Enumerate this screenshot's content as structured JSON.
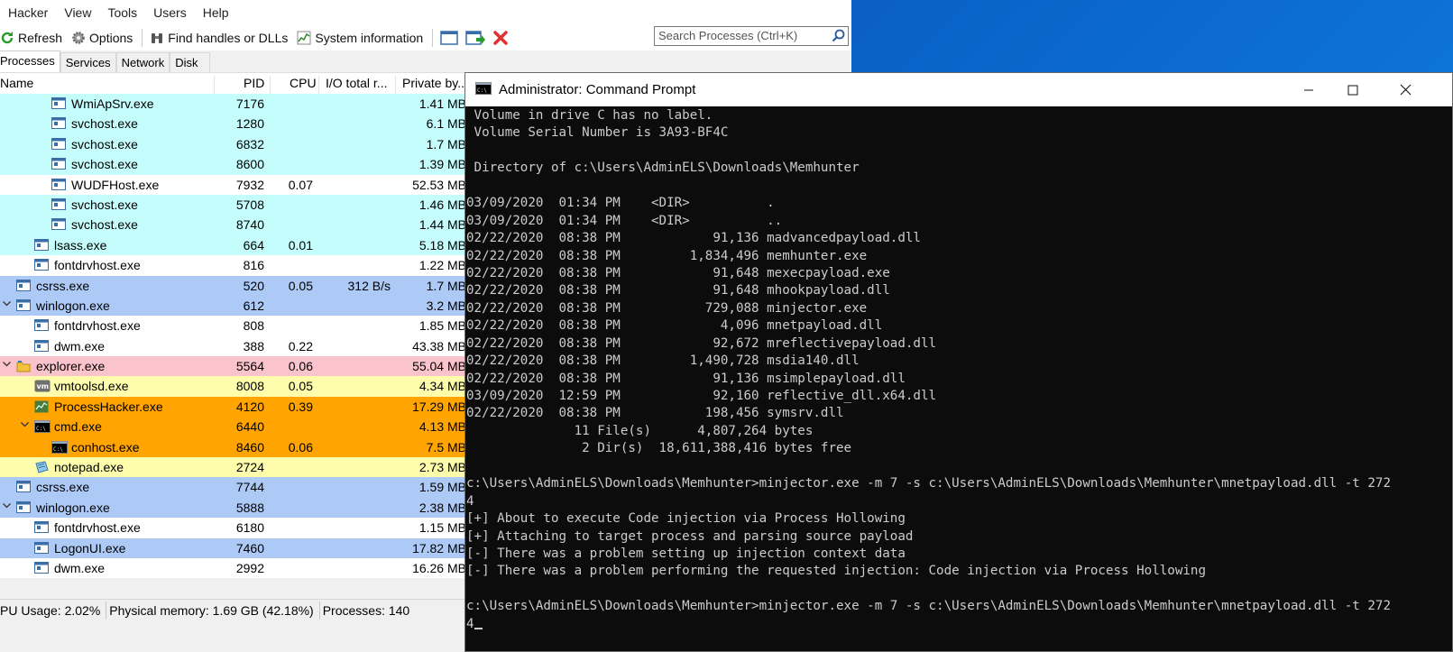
{
  "process_hacker": {
    "menu": [
      "Hacker",
      "View",
      "Tools",
      "Users",
      "Help"
    ],
    "toolbar": {
      "refresh": "Refresh",
      "options": "Options",
      "find_handles": "Find handles or DLLs",
      "system_info": "System information"
    },
    "search_placeholder": "Search Processes (Ctrl+K)",
    "tabs": [
      "Processes",
      "Services",
      "Network",
      "Disk"
    ],
    "columns": {
      "name": "Name",
      "pid": "PID",
      "cpu": "CPU",
      "io": "I/O total r...",
      "private": "Private by..."
    },
    "rows": [
      {
        "name": "WmiApSrv.exe",
        "pid": "7176",
        "cpu": "",
        "io": "",
        "private": "1.41 MB",
        "indent": 3,
        "bg": "#c5fdfd",
        "icon": "window-icon"
      },
      {
        "name": "svchost.exe",
        "pid": "1280",
        "cpu": "",
        "io": "",
        "private": "6.1 MB",
        "indent": 3,
        "bg": "#c5fdfd",
        "icon": "window-icon"
      },
      {
        "name": "svchost.exe",
        "pid": "6832",
        "cpu": "",
        "io": "",
        "private": "1.7 MB",
        "indent": 3,
        "bg": "#c5fdfd",
        "icon": "window-icon"
      },
      {
        "name": "svchost.exe",
        "pid": "8600",
        "cpu": "",
        "io": "",
        "private": "1.39 MB",
        "indent": 3,
        "bg": "#c5fdfd",
        "icon": "window-icon"
      },
      {
        "name": "WUDFHost.exe",
        "pid": "7932",
        "cpu": "0.07",
        "io": "",
        "private": "52.53 MB",
        "indent": 3,
        "bg": "#ffffff",
        "icon": "window-icon"
      },
      {
        "name": "svchost.exe",
        "pid": "5708",
        "cpu": "",
        "io": "",
        "private": "1.46 MB",
        "indent": 3,
        "bg": "#c5fdfd",
        "icon": "window-icon"
      },
      {
        "name": "svchost.exe",
        "pid": "8740",
        "cpu": "",
        "io": "",
        "private": "1.44 MB",
        "indent": 3,
        "bg": "#c5fdfd",
        "icon": "window-icon"
      },
      {
        "name": "lsass.exe",
        "pid": "664",
        "cpu": "0.01",
        "io": "",
        "private": "5.18 MB",
        "indent": 2,
        "bg": "#c5fdfd",
        "icon": "window-icon"
      },
      {
        "name": "fontdrvhost.exe",
        "pid": "816",
        "cpu": "",
        "io": "",
        "private": "1.22 MB",
        "indent": 2,
        "bg": "#ffffff",
        "icon": "window-icon"
      },
      {
        "name": "csrss.exe",
        "pid": "520",
        "cpu": "0.05",
        "io": "312 B/s",
        "private": "1.7 MB",
        "indent": 1,
        "bg": "#adcaf6",
        "icon": "window-icon"
      },
      {
        "name": "winlogon.exe",
        "pid": "612",
        "cpu": "",
        "io": "",
        "private": "3.2 MB",
        "indent": 1,
        "bg": "#adcaf6",
        "icon": "window-icon",
        "expand": true
      },
      {
        "name": "fontdrvhost.exe",
        "pid": "808",
        "cpu": "",
        "io": "",
        "private": "1.85 MB",
        "indent": 2,
        "bg": "#ffffff",
        "icon": "window-icon"
      },
      {
        "name": "dwm.exe",
        "pid": "388",
        "cpu": "0.22",
        "io": "",
        "private": "43.38 MB",
        "indent": 2,
        "bg": "#ffffff",
        "icon": "window-icon"
      },
      {
        "name": "explorer.exe",
        "pid": "5564",
        "cpu": "0.06",
        "io": "",
        "private": "55.04 MB",
        "indent": 1,
        "bg": "#fbc3cc",
        "icon": "folder-icon",
        "expand": true
      },
      {
        "name": "vmtoolsd.exe",
        "pid": "8008",
        "cpu": "0.05",
        "io": "",
        "private": "4.34 MB",
        "indent": 2,
        "bg": "#fdfdac",
        "icon": "vm-icon"
      },
      {
        "name": "ProcessHacker.exe",
        "pid": "4120",
        "cpu": "0.39",
        "io": "",
        "private": "17.29 MB",
        "indent": 2,
        "bg": "#ffa400",
        "icon": "processhacker-icon"
      },
      {
        "name": "cmd.exe",
        "pid": "6440",
        "cpu": "",
        "io": "",
        "private": "4.13 MB",
        "indent": 2,
        "bg": "#ffa400",
        "icon": "console-icon",
        "expand": true
      },
      {
        "name": "conhost.exe",
        "pid": "8460",
        "cpu": "0.06",
        "io": "",
        "private": "7.5 MB",
        "indent": 3,
        "bg": "#ffa400",
        "icon": "console-icon"
      },
      {
        "name": "notepad.exe",
        "pid": "2724",
        "cpu": "",
        "io": "",
        "private": "2.73 MB",
        "indent": 2,
        "bg": "#fdfdac",
        "icon": "notepad-icon"
      },
      {
        "name": "csrss.exe",
        "pid": "7744",
        "cpu": "",
        "io": "",
        "private": "1.59 MB",
        "indent": 1,
        "bg": "#adcaf6",
        "icon": "window-icon"
      },
      {
        "name": "winlogon.exe",
        "pid": "5888",
        "cpu": "",
        "io": "",
        "private": "2.38 MB",
        "indent": 1,
        "bg": "#adcaf6",
        "icon": "window-icon",
        "expand": true
      },
      {
        "name": "fontdrvhost.exe",
        "pid": "6180",
        "cpu": "",
        "io": "",
        "private": "1.15 MB",
        "indent": 2,
        "bg": "#ffffff",
        "icon": "window-icon"
      },
      {
        "name": "LogonUI.exe",
        "pid": "7460",
        "cpu": "",
        "io": "",
        "private": "17.82 MB",
        "indent": 2,
        "bg": "#adcaf6",
        "icon": "window-icon"
      },
      {
        "name": "dwm.exe",
        "pid": "2992",
        "cpu": "",
        "io": "",
        "private": "16.26 MB",
        "indent": 2,
        "bg": "#ffffff",
        "icon": "window-icon"
      }
    ],
    "status": {
      "cpu": "PU Usage: 2.02%",
      "memory": "Physical memory: 1.69 GB (42.18%)",
      "processes": "Processes: 140"
    }
  },
  "cmd": {
    "title": "Administrator: Command Prompt",
    "lines": [
      " Volume in drive C has no label.",
      " Volume Serial Number is 3A93-BF4C",
      "",
      " Directory of c:\\Users\\AdminELS\\Downloads\\Memhunter",
      "",
      "03/09/2020  01:34 PM    <DIR>          .",
      "03/09/2020  01:34 PM    <DIR>          ..",
      "02/22/2020  08:38 PM            91,136 madvancedpayload.dll",
      "02/22/2020  08:38 PM         1,834,496 memhunter.exe",
      "02/22/2020  08:38 PM            91,648 mexecpayload.exe",
      "02/22/2020  08:38 PM            91,648 mhookpayload.dll",
      "02/22/2020  08:38 PM           729,088 minjector.exe",
      "02/22/2020  08:38 PM             4,096 mnetpayload.dll",
      "02/22/2020  08:38 PM            92,672 mreflectivepayload.dll",
      "02/22/2020  08:38 PM         1,490,728 msdia140.dll",
      "02/22/2020  08:38 PM            91,136 msimplepayload.dll",
      "03/09/2020  12:59 PM            92,160 reflective_dll.x64.dll",
      "02/22/2020  08:38 PM           198,456 symsrv.dll",
      "              11 File(s)      4,807,264 bytes",
      "               2 Dir(s)  18,611,388,416 bytes free",
      "",
      "c:\\Users\\AdminELS\\Downloads\\Memhunter>minjector.exe -m 7 -s c:\\Users\\AdminELS\\Downloads\\Memhunter\\mnetpayload.dll -t 272",
      "4",
      "[+] About to execute Code injection via Process Hollowing",
      "[+] Attaching to target process and parsing source payload",
      "[-] There was a problem setting up injection context data",
      "[-] There was a problem performing the requested injection: Code injection via Process Hollowing",
      "",
      "c:\\Users\\AdminELS\\Downloads\\Memhunter>minjector.exe -m 7 -s c:\\Users\\AdminELS\\Downloads\\Memhunter\\mnetpayload.dll -t 272",
      "4"
    ]
  }
}
